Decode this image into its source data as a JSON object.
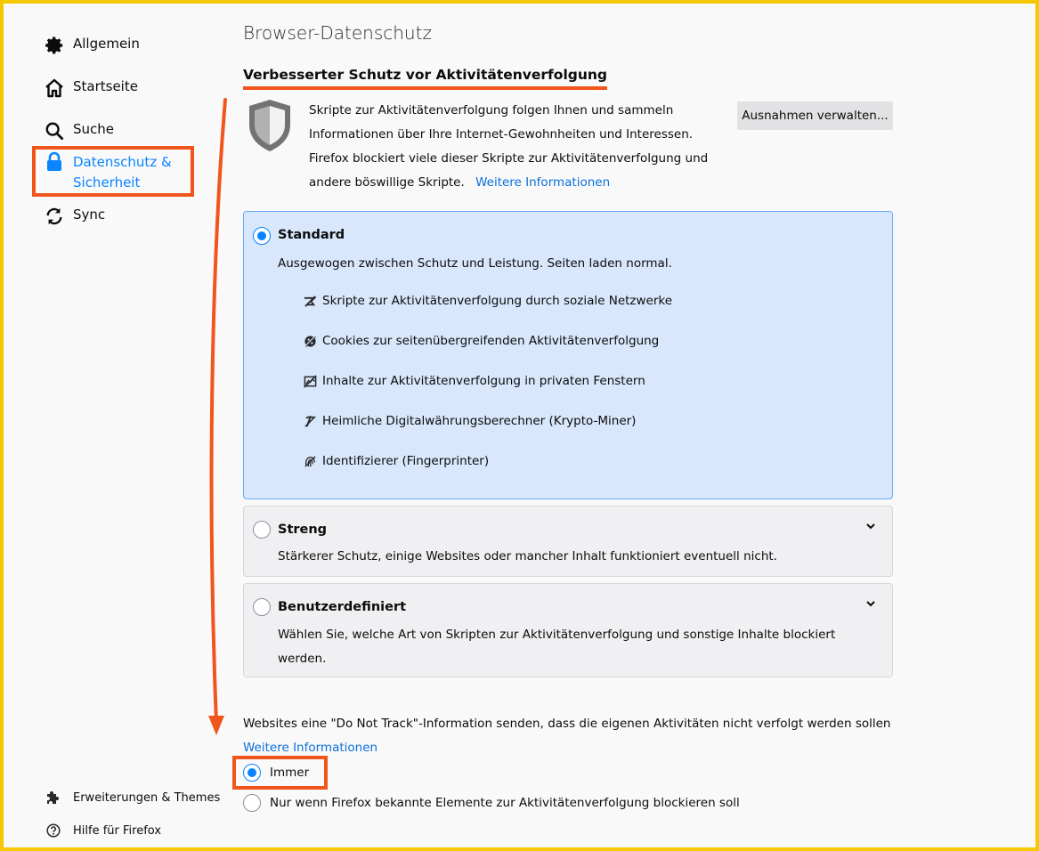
{
  "sidebar": {
    "items": [
      {
        "label": "Allgemein",
        "icon": "gear-icon"
      },
      {
        "label": "Startseite",
        "icon": "home-icon"
      },
      {
        "label": "Suche",
        "icon": "search-icon"
      },
      {
        "label_line1": "Datenschutz &",
        "label_line2": "Sicherheit",
        "icon": "lock-icon",
        "active": true
      },
      {
        "label": "Sync",
        "icon": "sync-icon"
      }
    ],
    "footer": [
      {
        "label": "Erweiterungen & Themes",
        "icon": "puzzle-icon"
      },
      {
        "label": "Hilfe für Firefox",
        "icon": "help-icon"
      }
    ]
  },
  "main": {
    "page_title": "Browser-Datenschutz",
    "section_title": "Verbesserter Schutz vor Aktivitätenverfolgung",
    "intro_text": "Skripte zur Aktivitätenverfolgung folgen Ihnen und sammeln Informationen über Ihre Internet-Gewohnheiten und Interessen. Firefox blockiert viele dieser Skripte zur Aktivitätenverfolgung und andere böswillige Skripte.",
    "intro_link": "Weitere Informationen",
    "exceptions_button": "Ausnahmen verwalten...",
    "options": {
      "standard": {
        "title": "Standard",
        "description": "Ausgewogen zwischen Schutz und Leistung. Seiten laden normal.",
        "features": [
          "Skripte zur Aktivitätenverfolgung durch soziale Netzwerke",
          "Cookies zur seitenübergreifenden Aktivitätenverfolgung",
          "Inhalte zur Aktivitätenverfolgung in privaten Fenstern",
          "Heimliche Digitalwährungsberechner (Krypto-Miner)",
          "Identifizierer (Fingerprinter)"
        ]
      },
      "streng": {
        "title": "Streng",
        "description": "Stärkerer Schutz, einige Websites oder mancher Inhalt funktioniert eventuell nicht."
      },
      "custom": {
        "title": "Benutzerdefiniert",
        "description": "Wählen Sie, welche Art von Skripten zur Aktivitätenverfolgung und sonstige Inhalte blockiert werden."
      }
    },
    "dnt": {
      "text": "Websites eine \"Do Not Track\"-Information senden, dass die eigenen Aktivitäten nicht verfolgt werden sollen",
      "link": "Weitere Informationen",
      "always": "Immer",
      "only_known": "Nur wenn Firefox bekannte Elemente zur Aktivitätenverfolgung blockieren soll"
    }
  },
  "colors": {
    "accent": "#0a84ff",
    "highlight": "#f0561c",
    "frame": "#f5c800",
    "selected_card": "#d8e7fb"
  }
}
